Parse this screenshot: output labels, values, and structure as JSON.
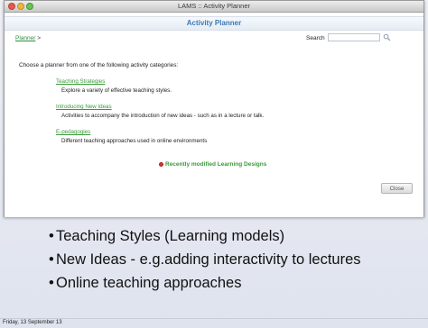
{
  "window": {
    "title": "LAMS :: Activity Planner"
  },
  "planner": {
    "title": "Activity Planner",
    "breadcrumb_link": "Planner",
    "breadcrumb_sep": ">",
    "search_label": "Search",
    "search_value": "",
    "search_icon": "magnifier-icon",
    "intro": "Choose a planner from one of the following activity categories:",
    "categories": [
      {
        "label": "Teaching Strategies",
        "description": "Explore a variety of effective teaching styles."
      },
      {
        "label": "Introducing New Ideas",
        "description": "Activities to accompany the introduction of new ideas - such as in a lecture or talk."
      },
      {
        "label": "E-pedagogies",
        "description": "Different teaching approaches used in online environments"
      }
    ],
    "recent_label": "Recently modified Learning Designs",
    "close_label": "Close"
  },
  "slide": {
    "bullets": [
      "Teaching Styles (Learning models)",
      "New Ideas - e.g.adding interactivity to lectures",
      "Online teaching approaches"
    ],
    "bullet_char": "•",
    "footer_date": "Friday, 13 September 13"
  },
  "colors": {
    "link_green": "#3a9a3a",
    "title_blue": "#3c78b5",
    "close_red": "#e8574e",
    "minimize_yellow": "#eeb644",
    "maximize_green": "#65c454"
  }
}
